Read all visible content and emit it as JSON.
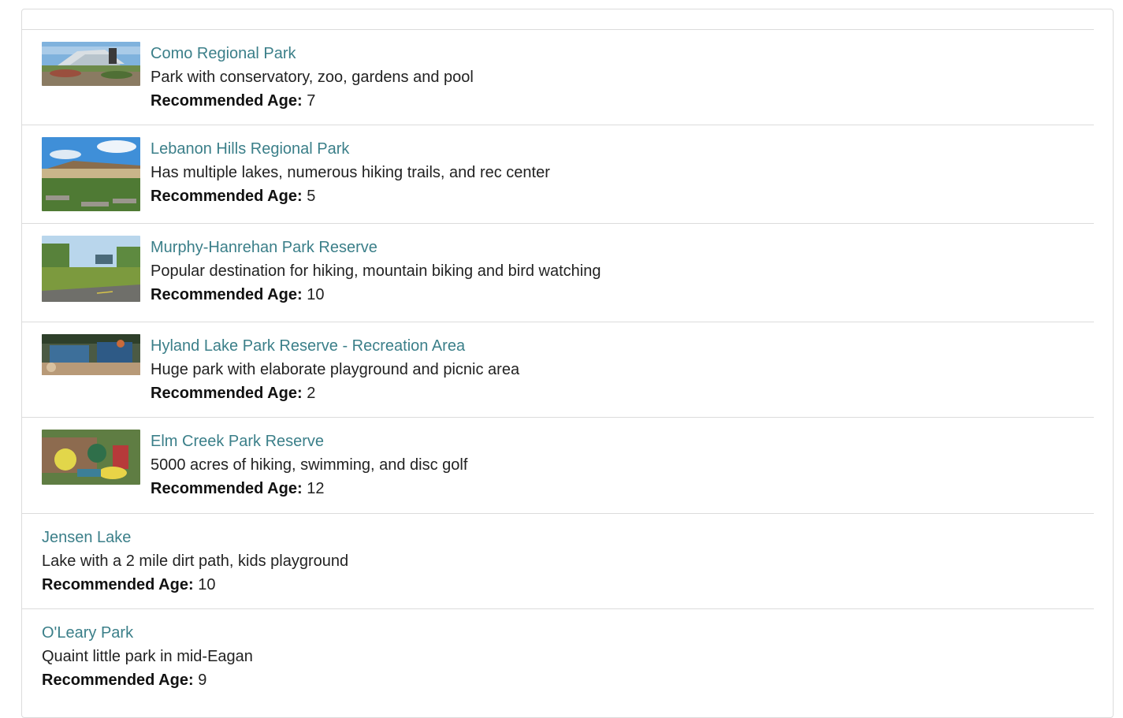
{
  "parks": [
    {
      "title": "Como Regional Park",
      "description": "Park with conservatory, zoo, gardens and pool",
      "age_label": "Recommended Age:",
      "age": "7",
      "thumbnail": "conservatory-photo"
    },
    {
      "title": "Lebanon Hills Regional Park",
      "description": "Has multiple lakes, numerous hiking trails, and rec center",
      "age_label": "Recommended Age:",
      "age": "5",
      "thumbnail": "rec-center-photo"
    },
    {
      "title": "Murphy-Hanrehan Park Reserve",
      "description": "Popular destination for hiking, mountain biking and bird watching",
      "age_label": "Recommended Age:",
      "age": "10",
      "thumbnail": "trail-sign-photo"
    },
    {
      "title": "Hyland Lake Park Reserve - Recreation Area",
      "description": "Huge park with elaborate playground and picnic area",
      "age_label": "Recommended Age:",
      "age": "2",
      "thumbnail": "playground-photo"
    },
    {
      "title": "Elm Creek Park Reserve",
      "description": "5000 acres of hiking, swimming, and disc golf",
      "age_label": "Recommended Age:",
      "age": "12",
      "thumbnail": "aerial-playground-photo"
    },
    {
      "title": "Jensen Lake",
      "description": "Lake with a 2 mile dirt path, kids playground",
      "age_label": "Recommended Age:",
      "age": "10"
    },
    {
      "title": "O'Leary Park",
      "description": "Quaint little park in mid-Eagan",
      "age_label": "Recommended Age:",
      "age": "9"
    }
  ],
  "colors": {
    "link": "#3b7f89",
    "border": "#dcdcdc"
  }
}
